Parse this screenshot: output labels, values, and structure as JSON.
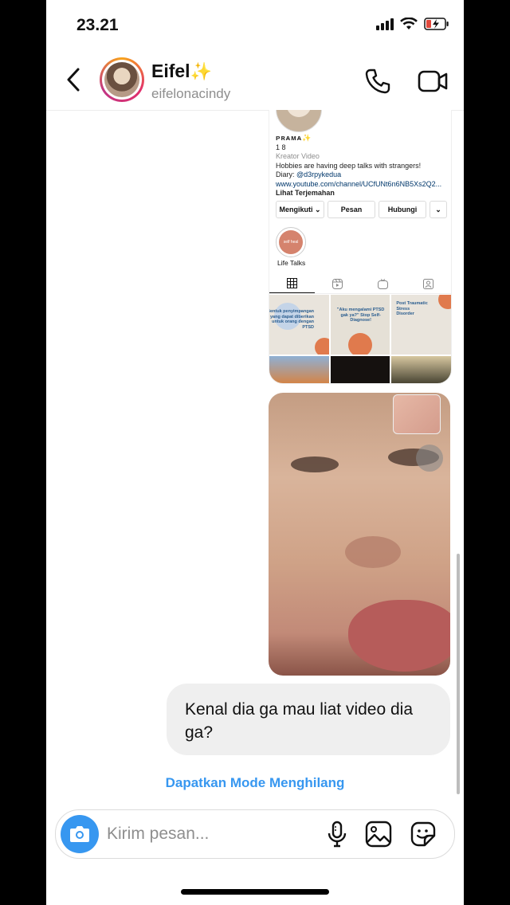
{
  "status_bar": {
    "time": "23.21",
    "icons": [
      "signal-icon",
      "wifi-icon",
      "battery-charging-icon"
    ]
  },
  "header": {
    "name": "Eifel",
    "name_emoji": "✨",
    "username": "eifelonacindy",
    "icons": [
      "back-chevron-icon",
      "phone-icon",
      "video-camera-icon"
    ]
  },
  "shared_profile": {
    "brand": "ᴘʀᴀᴍᴀ",
    "brand_emoji": "✨",
    "counts": "1 8",
    "category": "Kreator Video",
    "bio_line": "Hobbies are having deep talks with strangers!",
    "diary_prefix": "Diary: ",
    "diary_handle": "@d3rpykedua",
    "link": "www.youtube.com/channel/UCfUNt6n6NB5Xs2Q2...",
    "translate": "Lihat Terjemahan",
    "buttons": [
      "Mengikuti ⌄",
      "Pesan",
      "Hubungi",
      "⌄"
    ],
    "highlight_badge": "self heal",
    "highlight_label": "Life Talks",
    "posts": [
      "Bentuk penyimpangan yang dapat diberikan untuk orang dengan PTSD",
      "\"Aku mengalami PTSD gak ya?\" Stop Self-Diagnose!",
      "Post Traumatic Stress Disorder"
    ]
  },
  "messages": [
    {
      "type": "photo",
      "from": "me"
    },
    {
      "type": "text",
      "from": "me",
      "text": "Kenal dia ga mau liat video dia ga?"
    }
  ],
  "vanish_mode_label": "Dapatkan Mode Menghilang",
  "composer": {
    "placeholder": "Kirim pesan..."
  },
  "colors": {
    "accent": "#3797f0",
    "bubble": "#efefef",
    "muted": "#8e8e8e"
  }
}
